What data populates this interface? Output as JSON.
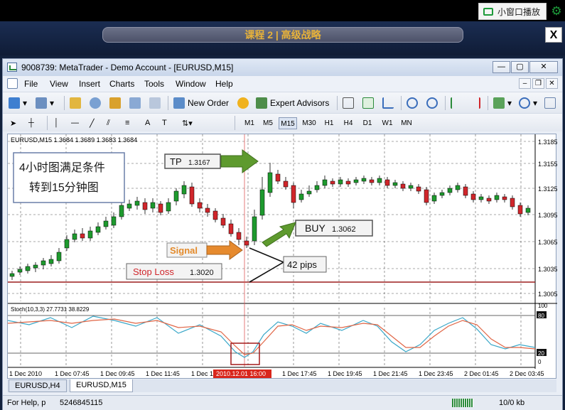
{
  "player": {
    "mini_window_label": "小窗口播放",
    "course_title": "课程 2 | 高级战略",
    "close_label": "X"
  },
  "window": {
    "title": "9008739: MetaTrader - Demo Account - [EURUSD,M15]",
    "buttons": [
      "—",
      "▢",
      "✕"
    ]
  },
  "menu": {
    "items": [
      "File",
      "View",
      "Insert",
      "Charts",
      "Tools",
      "Window",
      "Help"
    ]
  },
  "toolbar": {
    "new_order": "New Order",
    "expert_advisors": "Expert Advisors"
  },
  "timeframes": [
    "M1",
    "M5",
    "M15",
    "M30",
    "H1",
    "H4",
    "D1",
    "W1",
    "MN"
  ],
  "active_timeframe": "M15",
  "chart": {
    "header": "EURUSD,M15  1.3684  1.3689  1.3683  1.3684",
    "price_labels": [
      "1.3185",
      "1.3155",
      "1.3125",
      "1.3095",
      "1.3065",
      "1.3035",
      "1.3005"
    ],
    "stoch_label": "Stoch(10,3,3) 27.7731 38.8229",
    "stoch_levels": [
      "100",
      "80",
      "20",
      "0"
    ],
    "time_labels": [
      "1 Dec 2010",
      "1 Dec 07:45",
      "1 Dec 09:45",
      "1 Dec 11:45",
      "1 Dec 1",
      "1 Dec 17:45",
      "1 Dec 19:45",
      "1 Dec 21:45",
      "1 Dec 23:45",
      "2 Dec 01:45",
      "2 Dec 03:45"
    ],
    "highlight_time": "2010.12.01 16:00",
    "note_line1": "4小时图满足条件",
    "note_line2": "转到15分钟图",
    "tp_label": "TP",
    "tp_value": "1.3167",
    "buy_label": "BUY",
    "buy_value": "1.3062",
    "signal_label": "Signal",
    "stop_label": "Stop Loss",
    "stop_value": "1.3020",
    "pips_label": "42 pips",
    "colors": {
      "up": "#1e9a2e",
      "down": "#d0262b",
      "stop_line": "#9c1d1d",
      "k_line": "#3aa7c8",
      "d_line": "#e06545"
    }
  },
  "tabs": [
    "EURUSD,H4",
    "EURUSD,M15"
  ],
  "active_tab": "EURUSD,M15",
  "status": {
    "help": "For Help, p",
    "code": "5246845115",
    "traffic": "10/0 kb"
  }
}
